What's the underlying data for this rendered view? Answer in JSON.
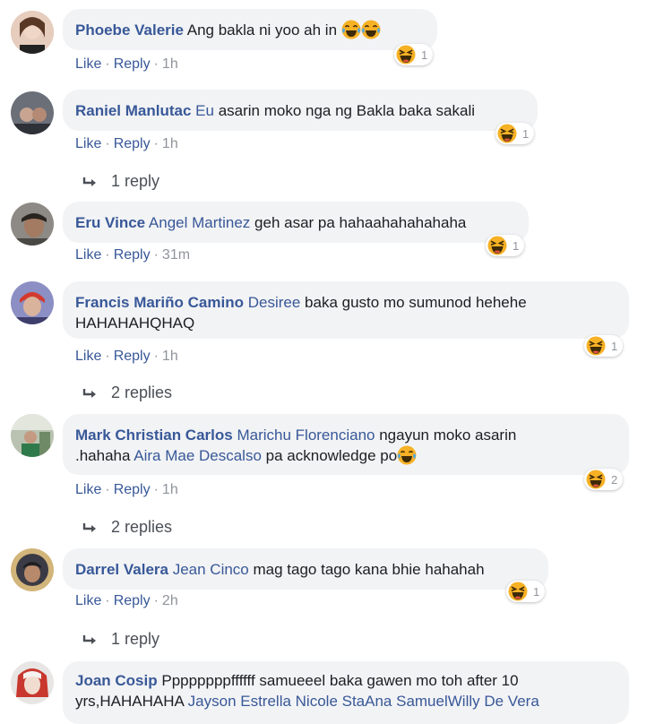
{
  "comments": [
    {
      "author": "Phoebe Valerie",
      "text": "Ang bakla ni yoo ah in",
      "like": "Like",
      "reply": "Reply",
      "time": "1h",
      "reaction_count": "1"
    },
    {
      "author": "Raniel Manlutac",
      "mention": "Eu",
      "text": "asarin moko nga ng Bakla baka sakali",
      "like": "Like",
      "reply": "Reply",
      "time": "1h",
      "reaction_count": "1",
      "replies": "1 reply"
    },
    {
      "author": "Eru Vince",
      "mention": "Angel Martinez",
      "text": "geh asar pa hahaahahahahaha",
      "like": "Like",
      "reply": "Reply",
      "time": "31m",
      "reaction_count": "1"
    },
    {
      "author": "Francis Mariño Camino",
      "mention": "Desiree",
      "text": "baka gusto mo sumunod hehehe",
      "text2": "HAHAHAHQHAQ",
      "like": "Like",
      "reply": "Reply",
      "time": "1h",
      "reaction_count": "1",
      "replies": "2 replies"
    },
    {
      "author": "Mark Christian Carlos",
      "mention": "Marichu Florenciano",
      "text": "ngayun moko asarin",
      "text2a": ".hahaha",
      "mention2": "Aira Mae Descalso",
      "text2b": "pa acknowledge po",
      "like": "Like",
      "reply": "Reply",
      "time": "1h",
      "reaction_count": "2",
      "replies": "2 replies"
    },
    {
      "author": "Darrel Valera",
      "mention": "Jean Cinco",
      "text": "mag tago tago kana bhie hahahah",
      "like": "Like",
      "reply": "Reply",
      "time": "2h",
      "reaction_count": "1",
      "replies": "1 reply"
    },
    {
      "author": "Joan Cosip",
      "text": "Ppppppppffffff samueeel baka gawen mo toh after 10",
      "text2": "yrs,HAHAHAHA",
      "mention2": "Jayson Estrella Nicole StaAna SamuelWilly De Vera"
    }
  ],
  "icons": {
    "reaction": "haha-emoji-icon",
    "reply_arrow": "reply-arrow-icon"
  },
  "colors": {
    "link": "#385898",
    "bubble": "#f2f3f5",
    "meta": "#90949c"
  }
}
